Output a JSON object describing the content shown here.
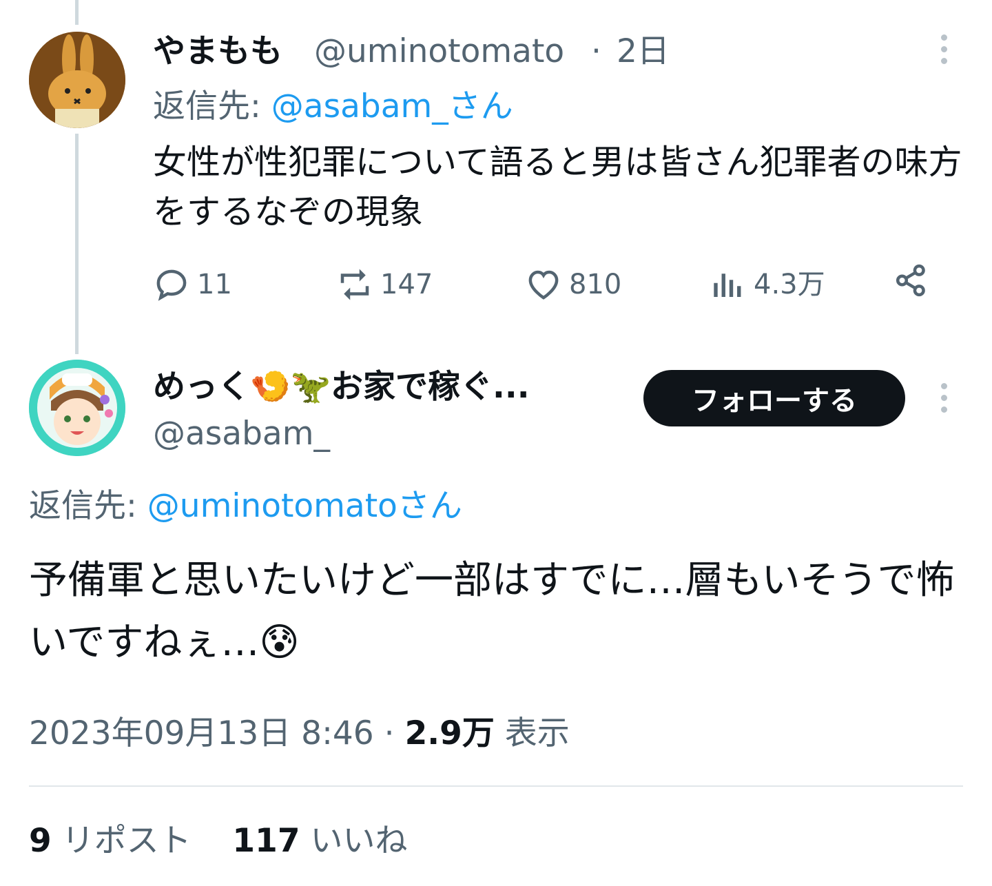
{
  "parent_tweet": {
    "display_name": "やまもも",
    "handle": "@uminotomato",
    "separator": "·",
    "time": "2日",
    "replying_prefix": "返信先: ",
    "replying_to": "@asabam_さん",
    "text": "女性が性犯罪について語ると男は皆さん犯罪者の味方をするなぞの現象",
    "actions": {
      "reply_count": "11",
      "repost_count": "147",
      "like_count": "810",
      "views_count": "4.3万"
    },
    "avatar_icon": "rabbit-avatar"
  },
  "main_tweet": {
    "display_name": "めっく🍤🦖お家で稼ぐ...",
    "handle": "@asabam_",
    "follow_label": "フォローする",
    "replying_prefix": "返信先: ",
    "replying_to": "@uminotomatoさん",
    "text": "予備軍と思いたいけど一部はすでに…層もいそうで怖いですねぇ…😰",
    "timestamp": "2023年09月13日 8:46",
    "separator": "·",
    "views_count": "2.9万",
    "views_label": "表示",
    "avatar_icon": "anime-girl-avatar"
  },
  "stats": {
    "repost_count": "9",
    "repost_label": "リポスト",
    "like_count": "117",
    "like_label": "いいね"
  },
  "colors": {
    "accent": "#1d9bf0",
    "secondary_text": "#536471",
    "primary_text": "#0f1419",
    "thread_line": "#cfd9de"
  }
}
